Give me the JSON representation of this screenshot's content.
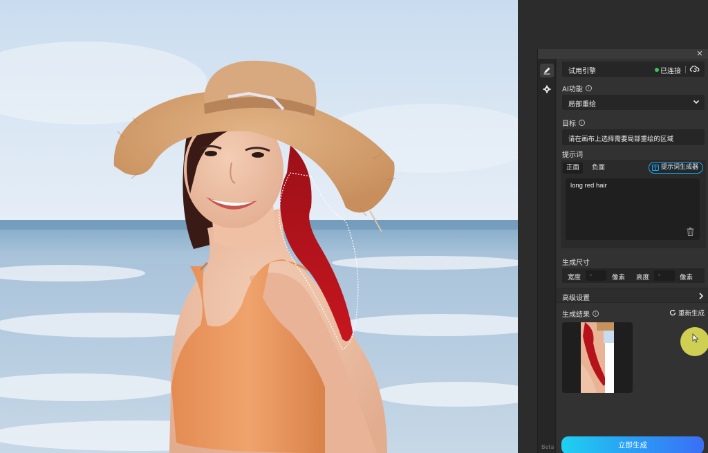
{
  "panel": {
    "close_symbol": "✕",
    "beta_label": "Beta",
    "engine": {
      "label": "试用引擎",
      "status": "已连接",
      "status_color": "#34c759"
    },
    "ai_function": {
      "label": "AI功能",
      "selected": "局部重绘"
    },
    "target": {
      "label": "目标",
      "value": "请在画布上选择需要局部重绘的区域"
    },
    "prompt": {
      "label": "提示词",
      "tabs": [
        "正面",
        "负面"
      ],
      "generator_button": "提示词生成器",
      "text": "long red hair",
      "accent_color": "#2da6e6"
    },
    "size": {
      "label": "生成尺寸",
      "width_label": "宽度",
      "width_value": "-",
      "height_label": "高度",
      "height_value": "-",
      "unit": "像素"
    },
    "advanced": {
      "label": "高级设置"
    },
    "result": {
      "label": "生成结果",
      "regenerate": "重新生成"
    },
    "generate_button": "立即生成"
  },
  "icons": {
    "rail": [
      "pen-icon",
      "gear-icon"
    ],
    "engine": "cloud-refresh-icon",
    "select": "chevron-down-icon",
    "advanced": "chevron-right-icon",
    "prompt_area": "trash-icon",
    "regenerate": "refresh-icon"
  }
}
